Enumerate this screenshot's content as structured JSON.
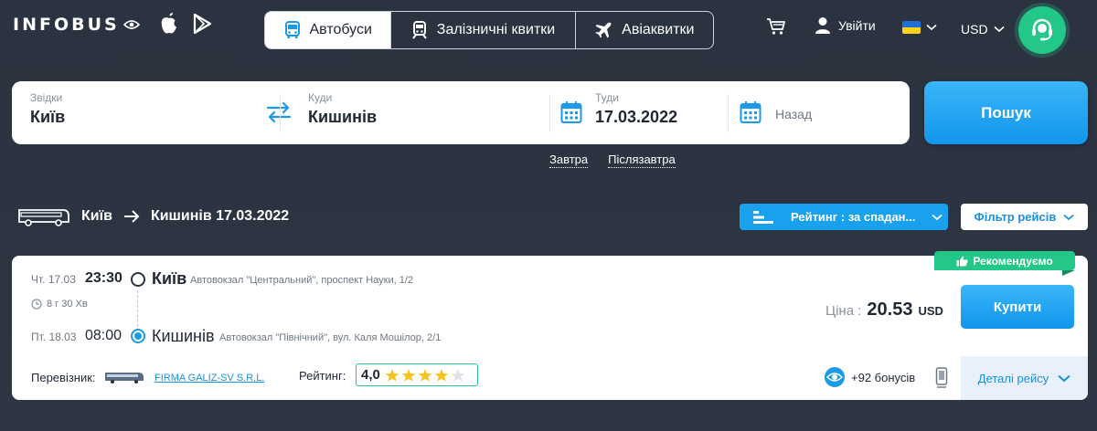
{
  "header": {
    "logo": "INFOBUS",
    "tabs": [
      {
        "label": "Автобуси",
        "icon": "bus-icon",
        "active": true
      },
      {
        "label": "Залізничні квитки",
        "icon": "train-icon",
        "active": false
      },
      {
        "label": "Авіаквитки",
        "icon": "plane-icon",
        "active": false
      }
    ],
    "login_label": "Увійти",
    "currency": "USD",
    "accent_color": "#23c788"
  },
  "search": {
    "from_label": "Звідки",
    "from_value": "Київ",
    "to_label": "Куди",
    "to_value": "Кишинів",
    "there_label": "Туди",
    "there_value": "17.03.2022",
    "back_placeholder": "Назад",
    "button_label": "Пошук",
    "quick_dates": [
      "Завтра",
      "Післязавтра"
    ]
  },
  "results": {
    "route_from": "Київ",
    "route_to_date": "Кишинів 17.03.2022",
    "sort_label": "Рейтинг : за спадан...",
    "filter_label": "Фільтр рейсів"
  },
  "trip": {
    "badge": "Рекомендуємо",
    "departure": {
      "day": "Чт. 17.03",
      "time": "23:30",
      "city": "Київ",
      "station": "Автовокзал \"Центральний\", проспект Науки, 1/2"
    },
    "duration": "8 г 30 Хв",
    "arrival": {
      "day": "Пт. 18.03",
      "time": "08:00",
      "city": "Кишинів",
      "station": "Автовокзал \"Північний\", вул. Каля Мошілор, 2/1"
    },
    "price_label": "Ціна :",
    "price_value": "20.53",
    "price_currency": "USD",
    "buy_label": "Купити",
    "carrier_label": "Перевізник:",
    "carrier_name": "FIRMA GALIZ-SV S.R.L.",
    "rating_label": "Рейтинг:",
    "rating_value": "4,0",
    "rating_stars": 4,
    "bonus_label": "+92 бонусів",
    "details_label": "Деталі рейсу"
  }
}
